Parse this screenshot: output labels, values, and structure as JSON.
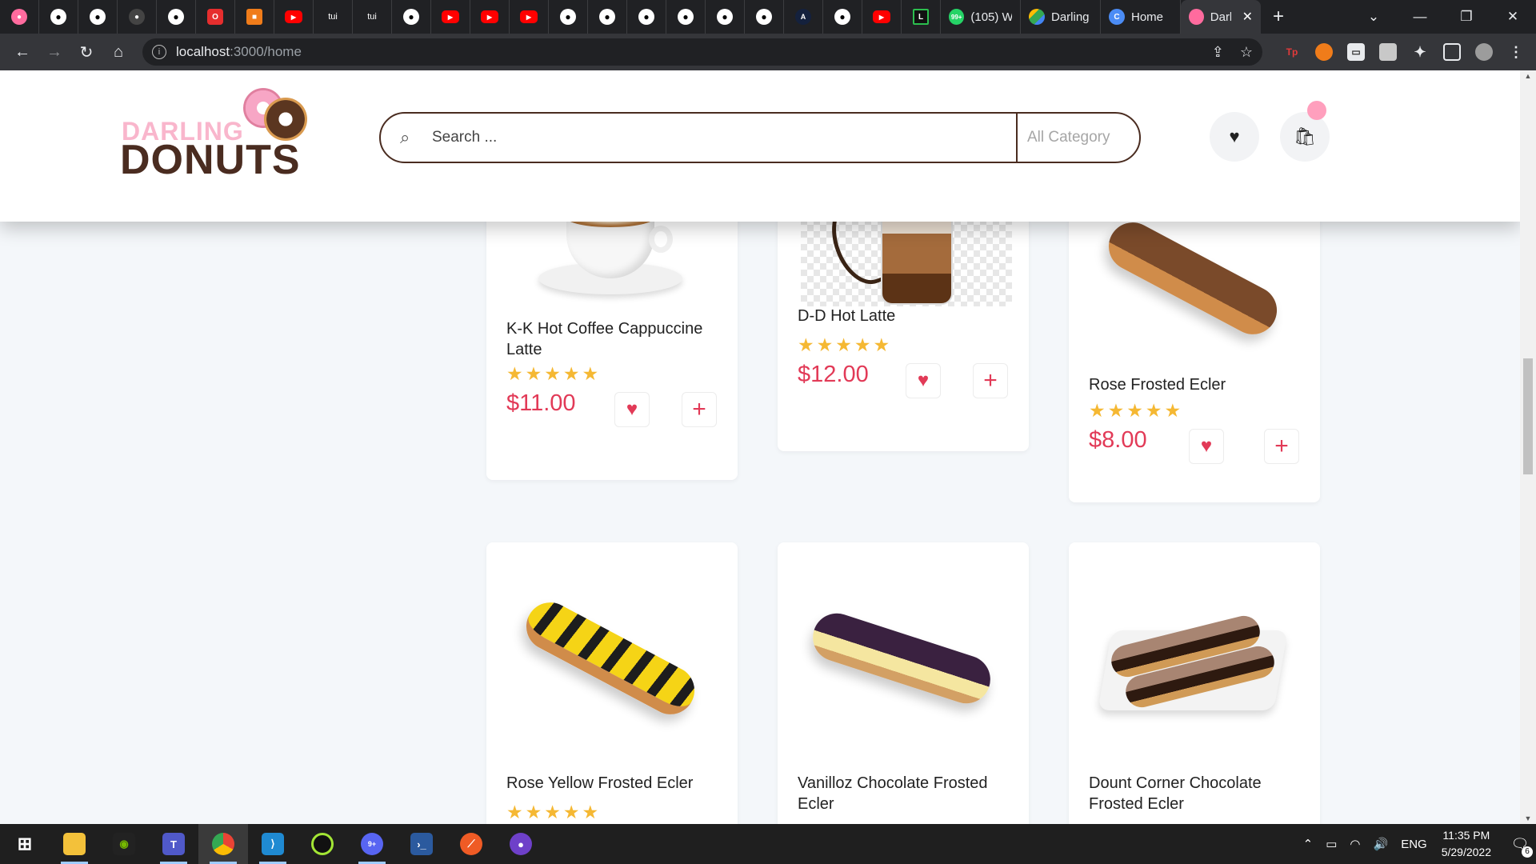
{
  "browser": {
    "mini_tabs": [
      {
        "icon": "tuenti-icon",
        "label": ""
      },
      {
        "icon": "github-icon",
        "label": ""
      },
      {
        "icon": "github-icon",
        "label": ""
      },
      {
        "icon": "github-icon",
        "label": ""
      },
      {
        "icon": "github-icon",
        "label": ""
      },
      {
        "icon": "opera-icon",
        "label": ""
      },
      {
        "icon": "box-icon",
        "label": ""
      },
      {
        "icon": "youtube-icon",
        "label": ""
      },
      {
        "icon": "text-icon",
        "label": "tui"
      },
      {
        "icon": "text-icon",
        "label": "tui"
      },
      {
        "icon": "github-icon",
        "label": ""
      },
      {
        "icon": "youtube-icon",
        "label": ""
      },
      {
        "icon": "youtube-icon",
        "label": ""
      },
      {
        "icon": "youtube-icon",
        "label": ""
      },
      {
        "icon": "github-icon",
        "label": ""
      },
      {
        "icon": "github-icon",
        "label": ""
      },
      {
        "icon": "github-icon",
        "label": ""
      },
      {
        "icon": "github-icon",
        "label": ""
      },
      {
        "icon": "github-icon",
        "label": ""
      },
      {
        "icon": "github-icon",
        "label": ""
      },
      {
        "icon": "angular-icon",
        "label": ""
      },
      {
        "icon": "github-icon",
        "label": ""
      },
      {
        "icon": "youtube-icon",
        "label": ""
      },
      {
        "icon": "l-icon",
        "label": ""
      }
    ],
    "wide_tabs": [
      {
        "icon": "whatsapp-icon",
        "badge": "99+",
        "label": "(105) W"
      },
      {
        "icon": "google-drive-icon",
        "label": "Darling"
      },
      {
        "icon": "page-icon",
        "label": "Home"
      },
      {
        "icon": "donut-icon",
        "label": "Darl",
        "active": true
      }
    ],
    "window_controls": [
      "⌄",
      "—",
      "❐",
      "✕"
    ],
    "url_host": "localhost",
    "url_path": ":3000/home"
  },
  "site": {
    "logo_top": "DARLING",
    "logo_bottom": "DONUTS",
    "search_placeholder": "Search ...",
    "category_label": "All Category"
  },
  "products": [
    {
      "name": "K-K Hot Coffee Cappuccine Latte",
      "price": "$11.00",
      "rating": 5
    },
    {
      "name": "D-D Hot Latte",
      "price": "$12.00",
      "rating": 5
    },
    {
      "name": "Rose Frosted Ecler",
      "price": "$8.00",
      "rating": 5
    },
    {
      "name": "Rose Yellow Frosted Ecler",
      "price": "",
      "rating": 5
    },
    {
      "name": "Vanilloz Chocolate Frosted Ecler",
      "price": "",
      "rating": 0
    },
    {
      "name": "Dount Corner Chocolate Frosted Ecler",
      "price": "",
      "rating": 0
    }
  ],
  "taskbar": {
    "language": "ENG",
    "time": "11:35 PM",
    "date": "5/29/2022",
    "notifications": "6",
    "chat_badge": "9+"
  },
  "colors": {
    "brand_brown": "#4a2c20",
    "price_red": "#e23a57",
    "star_yellow": "#f5b833",
    "logo_pink": "#f9b6cc"
  }
}
